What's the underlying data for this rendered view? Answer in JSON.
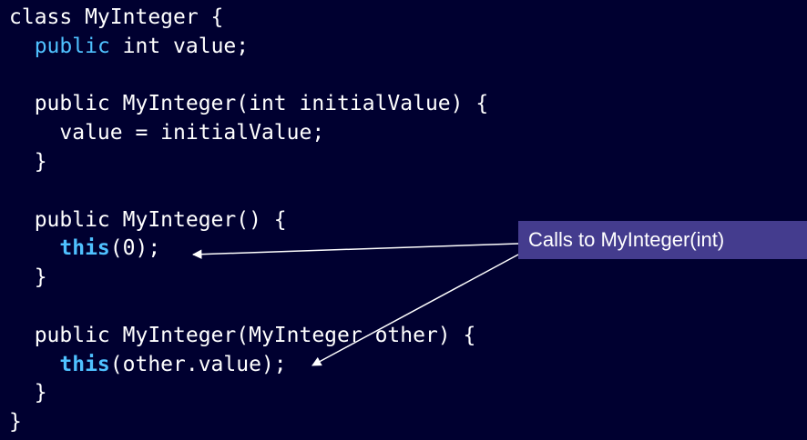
{
  "code": {
    "lines": [
      [
        {
          "t": "class MyInteger {",
          "s": ""
        }
      ],
      [
        {
          "t": "  ",
          "s": ""
        },
        {
          "t": "public",
          "s": "kw"
        },
        {
          "t": " int value;",
          "s": ""
        }
      ],
      [
        {
          "t": "",
          "s": ""
        }
      ],
      [
        {
          "t": "  public MyInteger(int initialValue) {",
          "s": ""
        }
      ],
      [
        {
          "t": "    value = initialValue;",
          "s": ""
        }
      ],
      [
        {
          "t": "  }",
          "s": ""
        }
      ],
      [
        {
          "t": "",
          "s": ""
        }
      ],
      [
        {
          "t": "  public MyInteger() {",
          "s": ""
        }
      ],
      [
        {
          "t": "    ",
          "s": ""
        },
        {
          "t": "this",
          "s": "this"
        },
        {
          "t": "(0);",
          "s": ""
        }
      ],
      [
        {
          "t": "  }",
          "s": ""
        }
      ],
      [
        {
          "t": "",
          "s": ""
        }
      ],
      [
        {
          "t": "  public MyInteger(MyInteger other) {",
          "s": ""
        }
      ],
      [
        {
          "t": "    ",
          "s": ""
        },
        {
          "t": "this",
          "s": "this"
        },
        {
          "t": "(other.value);",
          "s": ""
        }
      ],
      [
        {
          "t": "  }",
          "s": ""
        }
      ],
      [
        {
          "t": "}",
          "s": ""
        }
      ]
    ]
  },
  "callout": {
    "label": "Calls to MyInteger(int)"
  },
  "colors": {
    "background": "#000030",
    "keyword": "#4fc1ff",
    "callout_fill": "#443c8e",
    "text": "#ffffff"
  }
}
